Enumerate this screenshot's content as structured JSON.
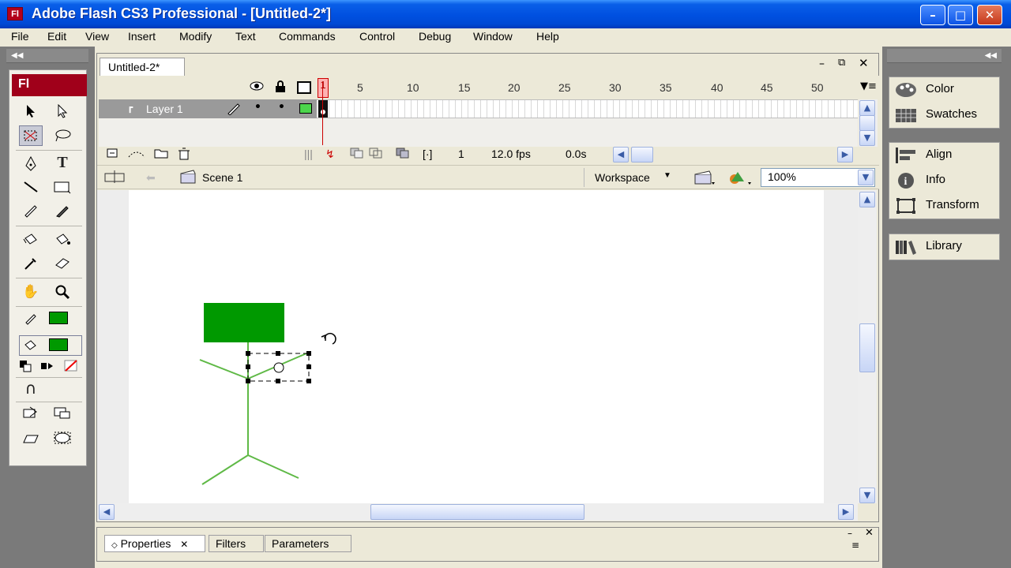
{
  "window": {
    "title": "Adobe Flash CS3 Professional - [Untitled-2*]",
    "icon": "Fl",
    "minimize": "–",
    "maximize": "□",
    "close": "✕"
  },
  "menu": [
    "File",
    "Edit",
    "View",
    "Insert",
    "Modify",
    "Text",
    "Commands",
    "Control",
    "Debug",
    "Window",
    "Help"
  ],
  "toolbox": {
    "logo": "Fl"
  },
  "document": {
    "tab": "Untitled-2*",
    "layer_name": "Layer 1",
    "frame_numbers": [
      "1",
      "5",
      "10",
      "15",
      "20",
      "25",
      "30",
      "35",
      "40",
      "45",
      "50"
    ],
    "current_frame": "1",
    "fps": "12.0 fps",
    "elapsed": "0.0s",
    "scene": "Scene 1",
    "workspace": "Workspace",
    "zoom": "100%"
  },
  "properties": {
    "tabs": [
      "Properties",
      "Filters",
      "Parameters"
    ]
  },
  "right_panels": {
    "group1": [
      "Color",
      "Swatches"
    ],
    "group2": [
      "Align",
      "Info",
      "Transform"
    ],
    "group3": [
      "Library"
    ]
  },
  "colors": {
    "stroke": "#009900",
    "fill": "#009900",
    "title_bar": "#0050e0",
    "stick_figure": "#5fb946"
  },
  "icons": {
    "eye": "eye-icon",
    "lock": "lock-icon",
    "outline": "outline-icon",
    "pencil": "pencil-icon",
    "trash": "trash-icon",
    "rotate": "rotate-icon"
  }
}
